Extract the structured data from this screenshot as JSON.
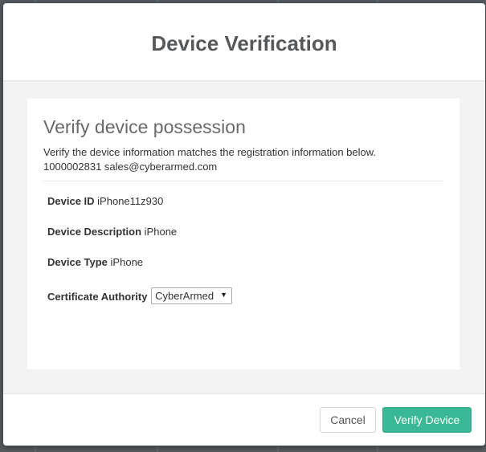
{
  "modal": {
    "title": "Device Verification"
  },
  "card": {
    "heading": "Verify device possession",
    "description": "Verify the device information matches the registration information below.",
    "account_line": "1000002831 sales@cyberarmed.com"
  },
  "fields": {
    "device_id": {
      "label": "Device ID",
      "value": "iPhone11z930"
    },
    "device_description": {
      "label": "Device Description",
      "value": "iPhone"
    },
    "device_type": {
      "label": "Device Type",
      "value": "iPhone"
    },
    "certificate_authority": {
      "label": "Certificate Authority",
      "selected": "CyberArmed"
    }
  },
  "footer": {
    "cancel_label": "Cancel",
    "verify_label": "Verify Device"
  },
  "colors": {
    "primary": "#3ab795",
    "title_text": "#55595c",
    "body_bg": "#f3f3f4"
  },
  "icons": {
    "select_arrow": "caret-down-icon"
  }
}
